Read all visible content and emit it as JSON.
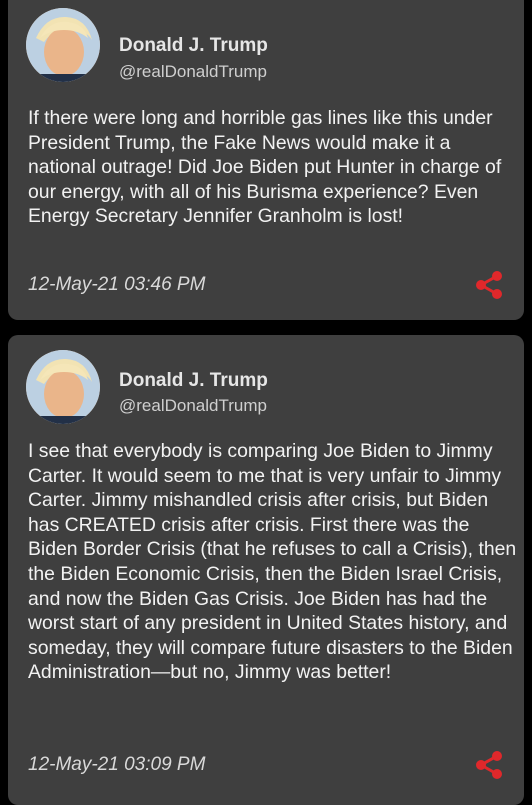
{
  "tweets": [
    {
      "name": "Donald J. Trump",
      "handle": "@realDonaldTrump",
      "text": "If there were long and horrible gas lines like this under President Trump, the Fake News would make it a national outrage! Did Joe Biden put Hunter in charge of our energy, with all of his Burisma experience? Even Energy Secretary Jennifer Granholm is lost!",
      "date": "12-May-21 03:46 PM",
      "share_icon": "share-icon"
    },
    {
      "name": "Donald J. Trump",
      "handle": "@realDonaldTrump",
      "text": "I see that everybody is comparing Joe Biden to Jimmy Carter. It would seem to me that is very unfair to Jimmy Carter. Jimmy mishandled crisis after crisis, but Biden has CREATED crisis after crisis. First there was the Biden Border Crisis (that he refuses to call a Crisis), then the Biden Economic Crisis, then the Biden Israel Crisis, and now the Biden Gas Crisis. Joe Biden has had the worst start of any president in United States history, and someday, they will compare future disasters to the Biden Administration—but no, Jimmy was better!",
      "date": "12-May-21 03:09 PM",
      "share_icon": "share-icon"
    }
  ],
  "colors": {
    "card": "#3f3f3f",
    "background": "#000000",
    "share": "#e0282b"
  }
}
